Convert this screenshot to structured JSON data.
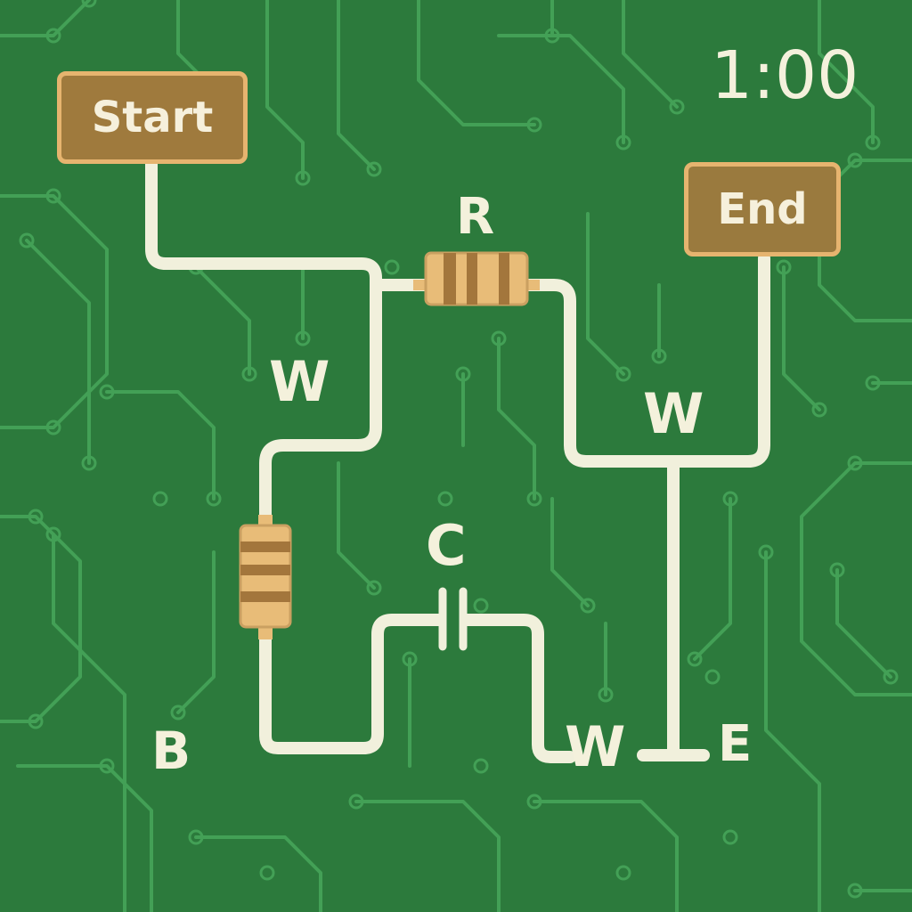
{
  "timer": "1:00",
  "buttons": {
    "start_label": "Start",
    "end_label": "End"
  },
  "component_labels": {
    "resistor_top": "R",
    "wire_left": "W",
    "wire_right": "W",
    "capacitor": "C",
    "battery": "B",
    "wire_bottom": "W",
    "end_marker": "E"
  },
  "colors": {
    "board": "#2c7a3c",
    "trace": "#3f9a52",
    "wire": "#f1f0dc",
    "tile_fill": "#9f7a3d",
    "tile_border": "#e6b46f",
    "resistor_body": "#e8bc78",
    "resistor_band": "#a3763c",
    "text": "#f4f1dc"
  }
}
